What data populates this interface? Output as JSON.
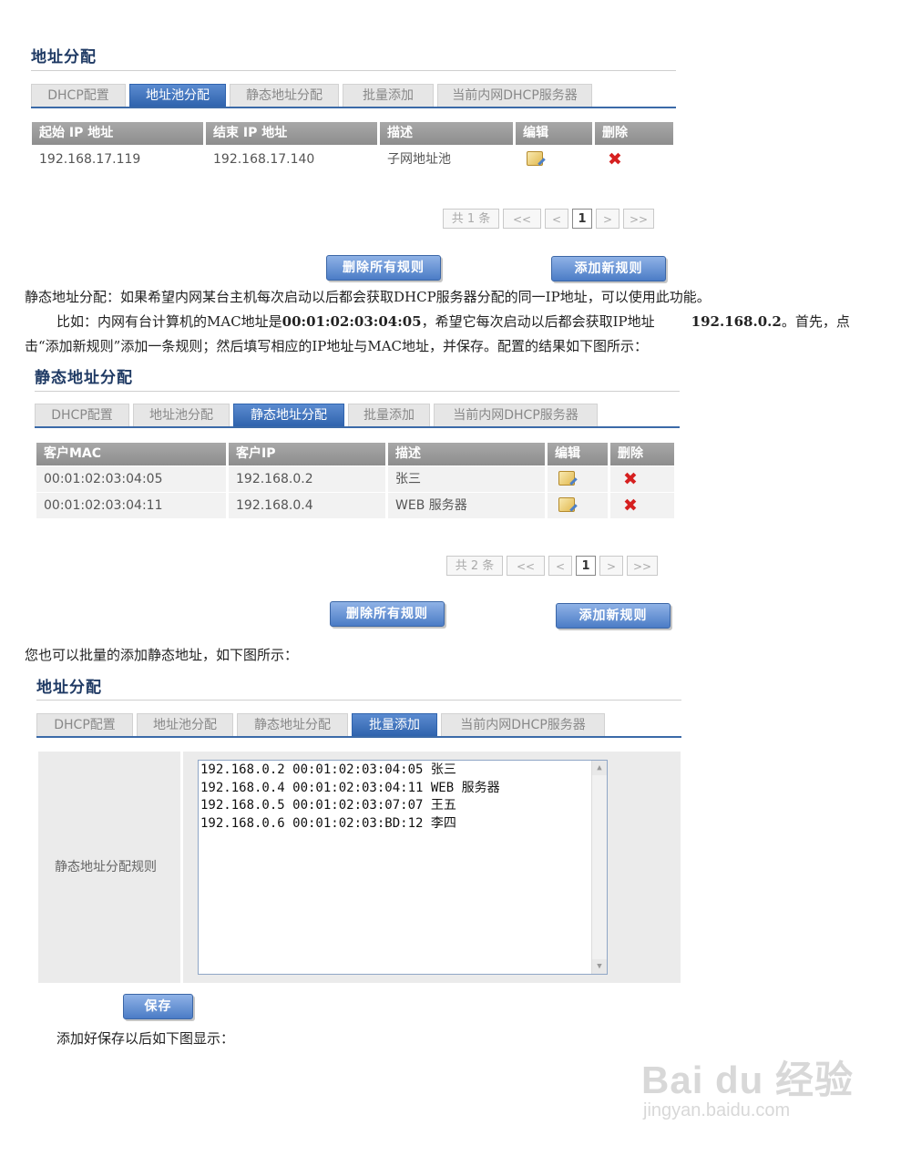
{
  "section1": {
    "title": "地址分配",
    "tabs": [
      "DHCP配置",
      "地址池分配",
      "静态地址分配",
      "批量添加",
      "当前内网DHCP服务器"
    ],
    "active_tab": 1,
    "columns": [
      "起始 IP 地址",
      "结束 IP 地址",
      "描述",
      "编辑",
      "删除"
    ],
    "rows": [
      {
        "start_ip": "192.168.17.119",
        "end_ip": "192.168.17.140",
        "desc": "子网地址池"
      }
    ],
    "pager": {
      "count": "共 1 条",
      "first": "<<",
      "prev": "<",
      "current": "1",
      "next": ">",
      "last": ">>"
    },
    "delete_all": "删除所有规则",
    "add_new": "添加新规则"
  },
  "para1": "静态地址分配：如果希望内网某台主机每次启动以后都会获取DHCP服务器分配的同一IP地址，可以使用此功能。",
  "para2": {
    "a": "比如：内网有台计算机的MAC地址是",
    "mac": "00:01:02:03:04:05",
    "b": "，希望它每次启动以后都会获取IP地址",
    "ip": "192.168.0.2",
    "c": "。首先，点",
    "line2": "击“添加新规则”添加一条规则；然后填写相应的IP地址与MAC地址，并保存。配置的结果如下图所示："
  },
  "section2": {
    "title": "静态地址分配",
    "tabs": [
      "DHCP配置",
      "地址池分配",
      "静态地址分配",
      "批量添加",
      "当前内网DHCP服务器"
    ],
    "active_tab": 2,
    "columns": [
      "客户MAC",
      "客户IP",
      "描述",
      "编辑",
      "删除"
    ],
    "rows": [
      {
        "mac": "00:01:02:03:04:05",
        "ip": "192.168.0.2",
        "desc": "张三"
      },
      {
        "mac": "00:01:02:03:04:11",
        "ip": "192.168.0.4",
        "desc": "WEB 服务器"
      }
    ],
    "pager": {
      "count": "共 2 条",
      "first": "<<",
      "prev": "<",
      "current": "1",
      "next": ">",
      "last": ">>"
    },
    "delete_all": "删除所有规则",
    "add_new": "添加新规则"
  },
  "para3": "您也可以批量的添加静态地址，如下图所示：",
  "section3": {
    "title": "地址分配",
    "tabs": [
      "DHCP配置",
      "地址池分配",
      "静态地址分配",
      "批量添加",
      "当前内网DHCP服务器"
    ],
    "active_tab": 3,
    "label": "静态地址分配规则",
    "lines": [
      "192.168.0.2 00:01:02:03:04:05 张三",
      "192.168.0.4 00:01:02:03:04:11 WEB 服务器",
      "192.168.0.5 00:01:02:03:07:07 王五",
      "192.168.0.6 00:01:02:03:BD:12 李四"
    ],
    "save": "保存"
  },
  "para4": "添加好保存以后如下图显示：",
  "watermark": {
    "brand": "Bai du 经验",
    "url": "jingyan.baidu.com"
  }
}
